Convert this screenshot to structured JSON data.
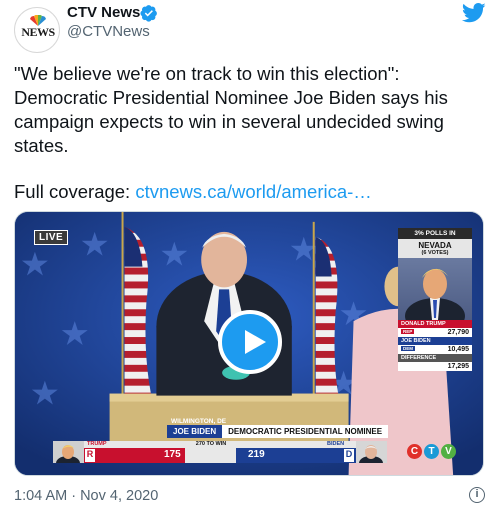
{
  "account": {
    "name": "CTV News",
    "handle": "@CTVNews",
    "logo_text": "NEWS",
    "verified": true
  },
  "tweet": {
    "text_lines": [
      "\"We believe we're on track to win this election\":",
      "Democratic Presidential Nominee Joe Biden says his",
      "campaign expects to win in several undecided swing",
      "states."
    ],
    "coverage_prefix": "Full coverage:",
    "link_text": "ctvnews.ca/world/america-…",
    "timestamp": "1:04 AM · Nov 4, 2020"
  },
  "video": {
    "live_badge": "LIVE",
    "location": "WILMINGTON, DE",
    "speaker_name": "JOE BIDEN",
    "speaker_title": "DEMOCRATIC PRESIDENTIAL NOMINEE",
    "panel": {
      "polls": "3% POLLS IN",
      "state": "NEVADA",
      "electoral_votes": "(6 VOTES)",
      "rep_label": "DONALD TRUMP",
      "rep_party": "REP",
      "rep_votes": "27,790",
      "dem_label": "JOE BIDEN",
      "dem_party": "DEM",
      "dem_votes": "10,495",
      "diff_label": "DIFFERENCE",
      "diff_votes": "17,295"
    },
    "scoreboard": {
      "trump_label": "TRUMP",
      "trump_letter": "R",
      "trump_votes": "175",
      "to_win": "270 TO WIN",
      "biden_label": "BIDEN",
      "biden_letter": "D",
      "biden_votes": "219"
    },
    "network_bug": [
      "C",
      "T",
      "V"
    ]
  },
  "colors": {
    "link": "#1d9bf0",
    "republican": "#c8102e",
    "democrat": "#1c3f94",
    "play_button": "#1d9bf0"
  },
  "icons": [
    "verified-badge-icon",
    "twitter-bird-icon",
    "play-icon",
    "info-icon"
  ]
}
